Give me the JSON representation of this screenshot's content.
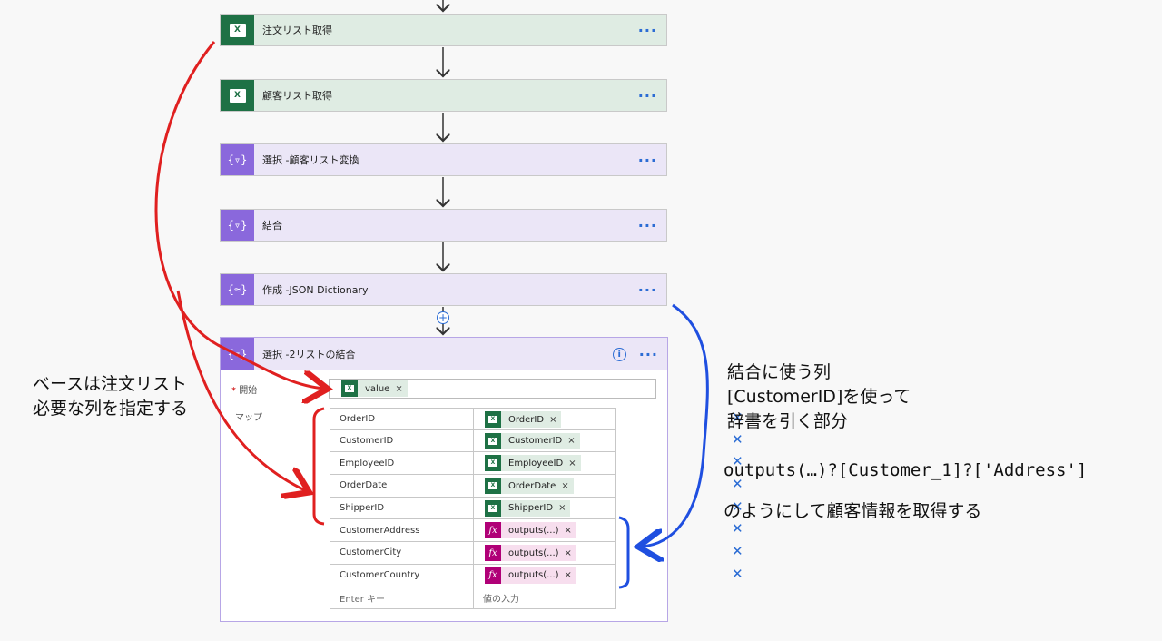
{
  "steps": [
    {
      "title": "注文リスト取得",
      "icon": "excel-icon"
    },
    {
      "title": "顧客リスト取得",
      "icon": "excel-icon"
    },
    {
      "title": "選択 -顧客リスト変換",
      "icon": "data-operation-icon"
    },
    {
      "title": "結合",
      "icon": "data-operation-icon"
    },
    {
      "title": "作成 -JSON Dictionary",
      "icon": "data-operation-icon"
    }
  ],
  "more": "···",
  "select_action": {
    "title": "選択 -2リストの結合",
    "start_label": "開始",
    "required_mark": "*",
    "map_label": "マップ",
    "start_value": "value",
    "rows": [
      {
        "key": "OrderID",
        "value": "OrderID",
        "type": "excel"
      },
      {
        "key": "CustomerID",
        "value": "CustomerID",
        "type": "excel"
      },
      {
        "key": "EmployeeID",
        "value": "EmployeeID",
        "type": "excel"
      },
      {
        "key": "OrderDate",
        "value": "OrderDate",
        "type": "excel"
      },
      {
        "key": "ShipperID",
        "value": "ShipperID",
        "type": "excel"
      },
      {
        "key": "CustomerAddress",
        "value": "outputs(...)",
        "type": "fx"
      },
      {
        "key": "CustomerCity",
        "value": "outputs(...)",
        "type": "fx"
      },
      {
        "key": "CustomerCountry",
        "value": "outputs(...)",
        "type": "fx"
      }
    ],
    "key_placeholder": "Enter キー",
    "value_placeholder": "値の入力",
    "remove_glyph": "×",
    "delete_glyph": "✕",
    "fx_glyph": "fx",
    "xl_glyph": "X",
    "info_glyph": "i"
  },
  "annotations": {
    "left_line1": "ベースは注文リスト",
    "left_line2": "必要な列を指定する",
    "right_line1": "結合に使う列",
    "right_line2": "[CustomerID]を使って",
    "right_line3": "辞書を引く部分",
    "code": "outputs(…)?[Customer_1]?['Address']",
    "right_line4": "のようにして顧客情報を取得する"
  },
  "colors": {
    "excel": "#1e7145",
    "purple": "#8a68dc",
    "red_arrow": "#e02020",
    "blue_arrow": "#1f4fe0"
  }
}
